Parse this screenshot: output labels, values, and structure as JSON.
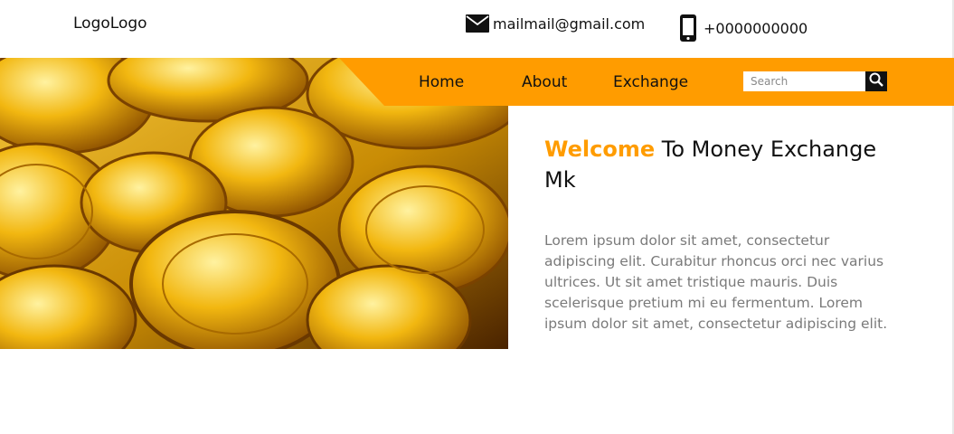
{
  "header": {
    "logo_text": "LogoLogo",
    "email": {
      "icon": "mail-icon",
      "text": "mailmail@gmail.com"
    },
    "phone": {
      "icon": "phone-icon",
      "text": "+0000000000"
    }
  },
  "nav": {
    "items": [
      {
        "label": "Home"
      },
      {
        "label": "About"
      },
      {
        "label": "Exchange"
      }
    ],
    "search": {
      "placeholder": "Search",
      "icon": "search-icon"
    }
  },
  "hero": {
    "image": "gold-coins-image",
    "welcome_accent": "Welcome",
    "welcome_rest": " To Money Exchange Mk",
    "body": "Lorem ipsum dolor sit amet, consectetur adipiscing elit. Curabitur rhoncus orci nec varius ultrices. Ut sit amet tristique mauris. Duis scelerisque pretium mi eu fermentum. Lorem ipsum dolor sit amet, consectetur adipiscing elit."
  },
  "colors": {
    "accent": "#ff9c00",
    "text": "#111111",
    "muted": "#7a7a7a"
  }
}
